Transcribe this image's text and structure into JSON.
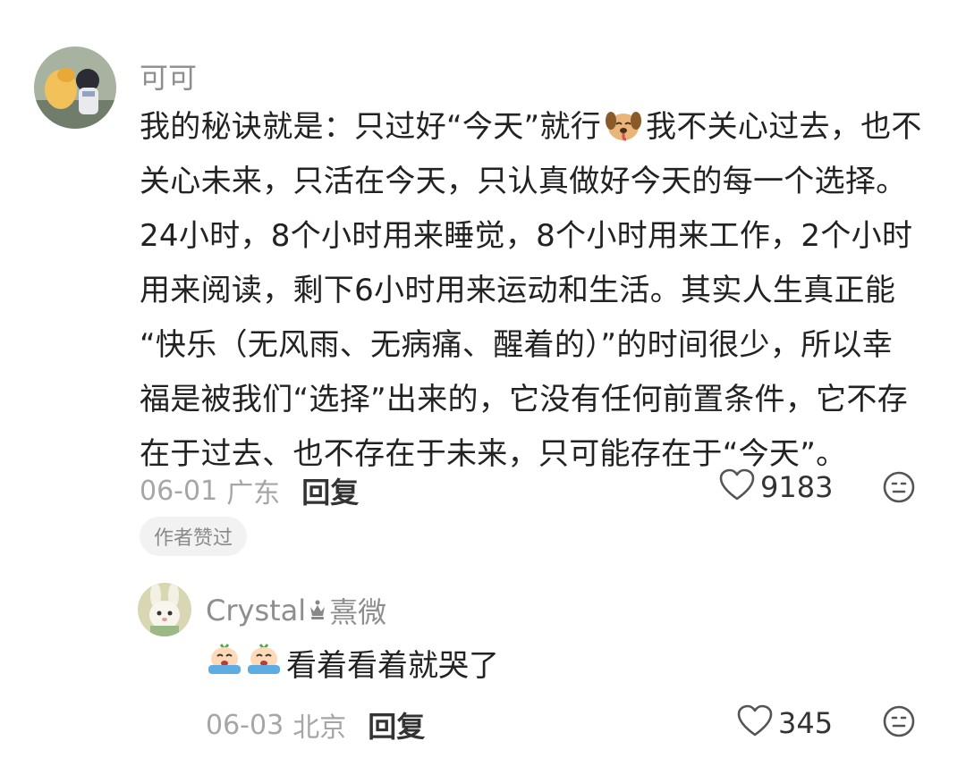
{
  "comment": {
    "username": "可可",
    "body_lines": [
      "我的秘诀就是：只过好“今天”就行",
      "我不关心过去，也不",
      "关心未来，只活在今天，只认真做好今天的每一个选择。",
      "24小时，8个小时用来睡觉，8个小时用来工作，2个小时",
      "用来阅读，剩下6小时用来运动和生活。其实人生真正能",
      "“快乐（无风雨、无病痛、醒着的）”的时间很少，所以幸",
      "福是被我们“选择”出来的，它没有任何前置条件，它不存",
      "在于过去、也不存在于未来，只可能存在于“今天”。"
    ],
    "inline_emoji": "dog-emoji",
    "date": "06-01",
    "region": "广东",
    "reply_label": "回复",
    "like_count": "9183",
    "author_badge": "作者赞过"
  },
  "reply": {
    "username": "Crystal",
    "username_suffix": "熹微",
    "crown_icon": "crown-icon",
    "emojis": [
      "crying-emoji",
      "crying-emoji"
    ],
    "text": "看着看着就哭了",
    "date": "06-03",
    "region": "北京",
    "reply_label": "回复",
    "like_count": "345"
  },
  "icons": {
    "like": "heart-outline-icon",
    "dislike": "meh-face-icon"
  },
  "colors": {
    "primary_text": "#222222",
    "secondary_text": "#a6a6a6",
    "badge_bg": "#f2f2f2"
  }
}
